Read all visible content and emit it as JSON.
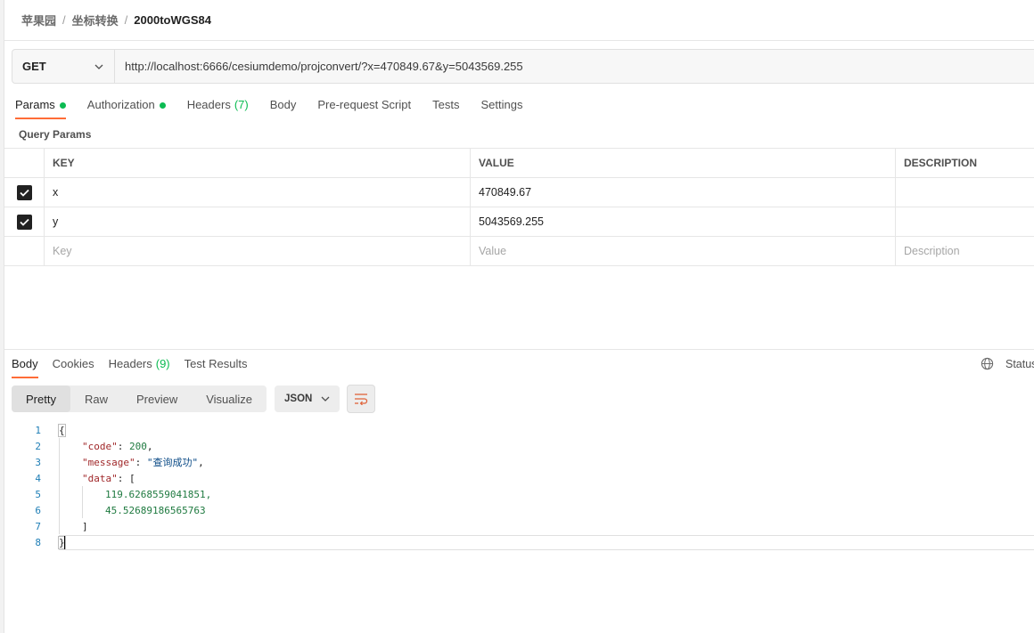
{
  "breadcrumb": [
    "苹果园",
    "坐标转换",
    "2000toWGS84"
  ],
  "request": {
    "method": "GET",
    "url": "http://localhost:6666/cesiumdemo/projconvert/?x=470849.67&y=5043569.255"
  },
  "request_tabs": [
    {
      "label": "Params",
      "dot": true,
      "active": true
    },
    {
      "label": "Authorization",
      "dot": true
    },
    {
      "label": "Headers",
      "count": "(7)"
    },
    {
      "label": "Body"
    },
    {
      "label": "Pre-request Script"
    },
    {
      "label": "Tests"
    },
    {
      "label": "Settings"
    }
  ],
  "query_params": {
    "label": "Query Params",
    "headers": {
      "key": "KEY",
      "value": "VALUE",
      "description": "DESCRIPTION"
    },
    "rows": [
      {
        "checked": true,
        "key": "x",
        "value": "470849.67",
        "description": ""
      },
      {
        "checked": true,
        "key": "y",
        "value": "5043569.255",
        "description": ""
      }
    ],
    "placeholders": {
      "key": "Key",
      "value": "Value",
      "description": "Description"
    }
  },
  "response_tabs": [
    {
      "label": "Body",
      "active": true
    },
    {
      "label": "Cookies"
    },
    {
      "label": "Headers",
      "count": "(9)"
    },
    {
      "label": "Test Results"
    }
  ],
  "status_label": "Status",
  "view_modes": [
    "Pretty",
    "Raw",
    "Preview",
    "Visualize"
  ],
  "active_view": "Pretty",
  "format": "JSON",
  "code_lines": [
    {
      "num": "1",
      "text": "{"
    },
    {
      "num": "2",
      "key": "\"code\"",
      "value": "200",
      "value_type": "n",
      "suffix": ","
    },
    {
      "num": "3",
      "key": "\"message\"",
      "value": "\"查询成功\"",
      "value_type": "s",
      "suffix": ","
    },
    {
      "num": "4",
      "key": "\"data\"",
      "value": "[",
      "value_type": "p",
      "suffix": ""
    },
    {
      "num": "5",
      "text": "119.6268559041851,",
      "type": "n"
    },
    {
      "num": "6",
      "text": "45.52689186565763",
      "type": "n"
    },
    {
      "num": "7",
      "text": "]"
    },
    {
      "num": "8",
      "text": "}"
    }
  ]
}
